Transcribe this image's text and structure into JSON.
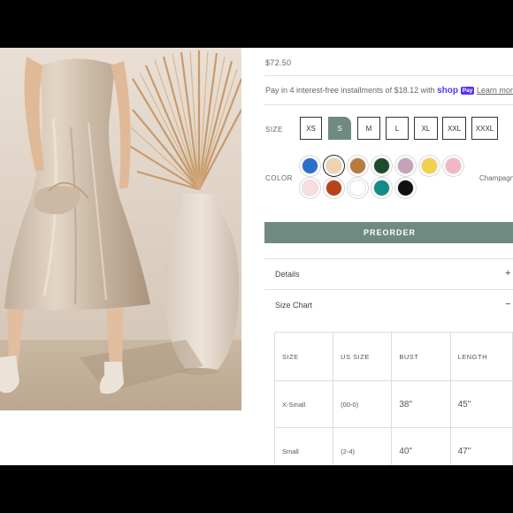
{
  "product": {
    "price": "$72.50",
    "installments": {
      "text": "Pay in 4 interest-free installments of $18.12 with",
      "shop_logo": "shop",
      "pay_badge": "Pay",
      "learn_more": "Learn more"
    }
  },
  "size_selector": {
    "label": "SIZE",
    "options": [
      "XS",
      "S",
      "M",
      "L",
      "XL",
      "XXL",
      "XXXL"
    ],
    "selected": "S"
  },
  "color_selector": {
    "label": "COLOR",
    "selected_name": "Champagne",
    "swatches": [
      {
        "name": "blue",
        "hex": "#2a6fc9"
      },
      {
        "name": "champagne",
        "hex": "#efd3b0",
        "selected": true
      },
      {
        "name": "caramel",
        "hex": "#b87a3e"
      },
      {
        "name": "dark-green",
        "hex": "#1f4a2c"
      },
      {
        "name": "mauve",
        "hex": "#c4a2b8"
      },
      {
        "name": "yellow",
        "hex": "#f2d14b"
      },
      {
        "name": "pink",
        "hex": "#f2b7c6"
      },
      {
        "name": "blush",
        "hex": "#f7dde0"
      },
      {
        "name": "rust",
        "hex": "#b8431b"
      },
      {
        "name": "white",
        "hex": "#ffffff"
      },
      {
        "name": "teal",
        "hex": "#128c86"
      },
      {
        "name": "black",
        "hex": "#111111"
      }
    ]
  },
  "actions": {
    "preorder_label": "PREORDER"
  },
  "accordion": {
    "details": {
      "title": "Details",
      "sign": "+"
    },
    "size_chart": {
      "title": "Size Chart",
      "sign": "−"
    }
  },
  "size_chart": {
    "headers": [
      "SIZE",
      "US SIZE",
      "BUST",
      "LENGTH"
    ],
    "rows": [
      [
        "X-Small",
        "(00-0)",
        "38\"",
        "45\""
      ],
      [
        "Small",
        "(2-4)",
        "40\"",
        "47\""
      ]
    ]
  },
  "colors": {
    "accent": "#6f8a80",
    "shop_purple": "#5a31f4"
  }
}
